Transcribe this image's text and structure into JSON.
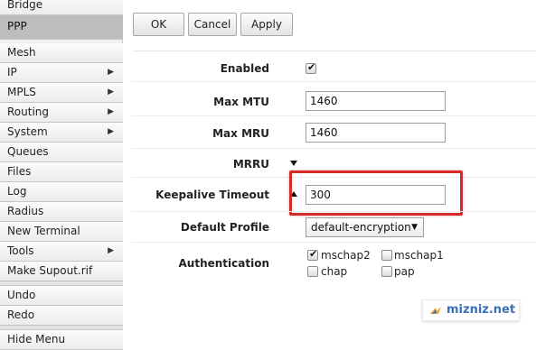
{
  "sidebar": {
    "items": [
      {
        "label": "Bridge",
        "submenu": false
      },
      {
        "label": "PPP",
        "submenu": false,
        "active": true
      },
      {
        "label": "Mesh",
        "submenu": false
      },
      {
        "label": "IP",
        "submenu": true
      },
      {
        "label": "MPLS",
        "submenu": true
      },
      {
        "label": "Routing",
        "submenu": true
      },
      {
        "label": "System",
        "submenu": true
      },
      {
        "label": "Queues",
        "submenu": false
      },
      {
        "label": "Files",
        "submenu": false
      },
      {
        "label": "Log",
        "submenu": false
      },
      {
        "label": "Radius",
        "submenu": false
      },
      {
        "label": "New Terminal",
        "submenu": false
      },
      {
        "label": "Tools",
        "submenu": true
      },
      {
        "label": "Make Supout.rif",
        "submenu": false
      },
      {
        "label": "Undo",
        "submenu": false
      },
      {
        "label": "Redo",
        "submenu": false
      },
      {
        "label": "Hide Menu",
        "submenu": false
      }
    ],
    "arrow_glyph": "▶"
  },
  "toolbar": {
    "ok_label": "OK",
    "cancel_label": "Cancel",
    "apply_label": "Apply"
  },
  "form": {
    "enabled": {
      "label": "Enabled",
      "checked": true
    },
    "max_mtu": {
      "label": "Max MTU",
      "value": "1460"
    },
    "max_mru": {
      "label": "Max MRU",
      "value": "1460"
    },
    "mrru": {
      "label": "MRRU",
      "expanded": false
    },
    "keepalive": {
      "label": "Keepalive Timeout",
      "value": "300"
    },
    "default_profile": {
      "label": "Default Profile",
      "value": "default-encryption"
    },
    "authentication": {
      "label": "Authentication",
      "options": [
        {
          "label": "mschap2",
          "checked": true
        },
        {
          "label": "mschap1",
          "checked": false
        },
        {
          "label": "chap",
          "checked": false
        },
        {
          "label": "pap",
          "checked": false
        }
      ]
    }
  },
  "watermark": {
    "text": "mizniz.net"
  },
  "colors": {
    "highlight": "#d42a2a",
    "active_item": "#bdbdbd",
    "watermark": "#3b6fb5"
  }
}
